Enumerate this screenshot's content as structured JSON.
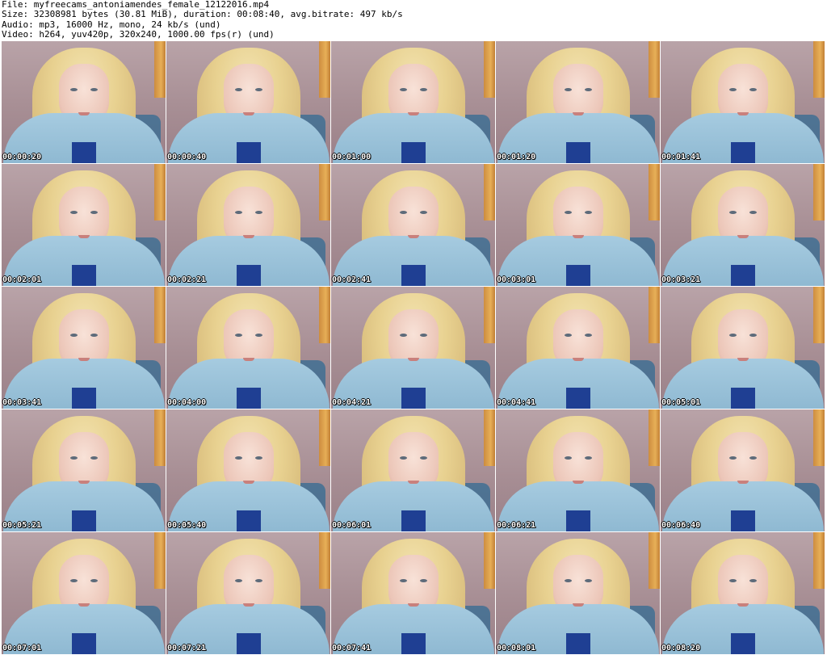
{
  "header": {
    "file_line": "File: myfreecams_antoniamendes_female_12122016.mp4",
    "size_line": "Size: 32308981 bytes (30.81 MiB), duration: 00:08:40, avg.bitrate: 497 kb/s",
    "audio_line": "Audio: mp3, 16000 Hz, mono, 24 kb/s (und)",
    "video_line": "Video: h264, yuv420p, 320x240, 1000.00 fps(r) (und)"
  },
  "thumbnails": [
    {
      "timestamp": "00:00:20"
    },
    {
      "timestamp": "00:00:40"
    },
    {
      "timestamp": "00:01:00"
    },
    {
      "timestamp": "00:01:20"
    },
    {
      "timestamp": "00:01:41"
    },
    {
      "timestamp": "00:02:01"
    },
    {
      "timestamp": "00:02:21"
    },
    {
      "timestamp": "00:02:41"
    },
    {
      "timestamp": "00:03:01"
    },
    {
      "timestamp": "00:03:21"
    },
    {
      "timestamp": "00:03:41"
    },
    {
      "timestamp": "00:04:00"
    },
    {
      "timestamp": "00:04:21"
    },
    {
      "timestamp": "00:04:41"
    },
    {
      "timestamp": "00:05:01"
    },
    {
      "timestamp": "00:05:21"
    },
    {
      "timestamp": "00:05:40"
    },
    {
      "timestamp": "00:06:01"
    },
    {
      "timestamp": "00:06:21"
    },
    {
      "timestamp": "00:06:40"
    },
    {
      "timestamp": "00:07:01"
    },
    {
      "timestamp": "00:07:21"
    },
    {
      "timestamp": "00:07:41"
    },
    {
      "timestamp": "00:08:01"
    },
    {
      "timestamp": "00:08:20"
    }
  ]
}
